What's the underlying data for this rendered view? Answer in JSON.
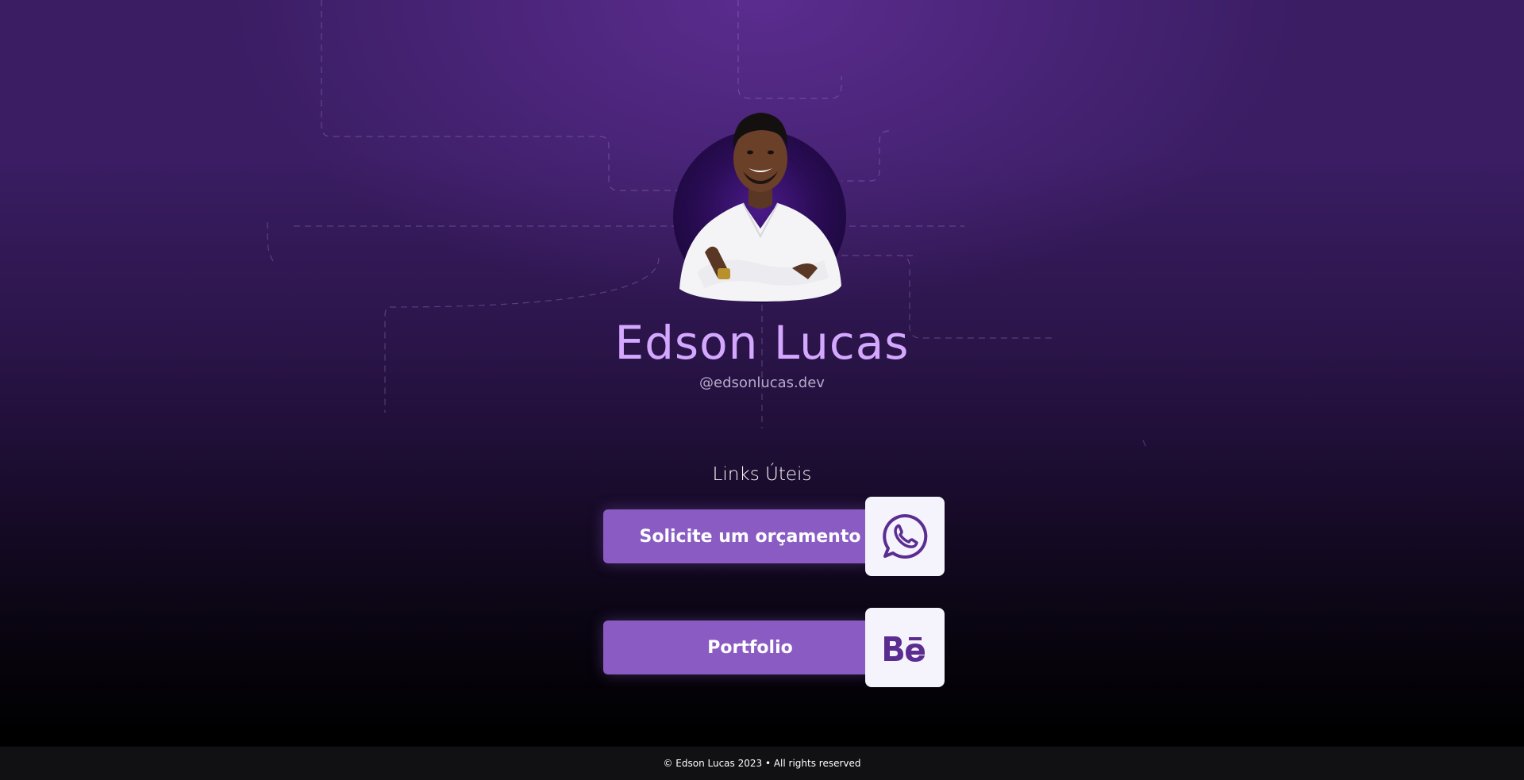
{
  "profile": {
    "name": "Edson Lucas",
    "handle": "@edsonlucas.dev"
  },
  "links_section": {
    "title": "Links Úteis",
    "items": [
      {
        "label": "Solicite um orçamento",
        "icon": "whatsapp-icon"
      },
      {
        "label": "Portfolio",
        "icon": "behance-icon"
      }
    ]
  },
  "footer": {
    "text": "© Edson Lucas 2023 • All rights reserved"
  },
  "colors": {
    "accent": "#8a5cc3",
    "name_color": "#d4a8ff",
    "icon_color": "#5b2d91"
  }
}
